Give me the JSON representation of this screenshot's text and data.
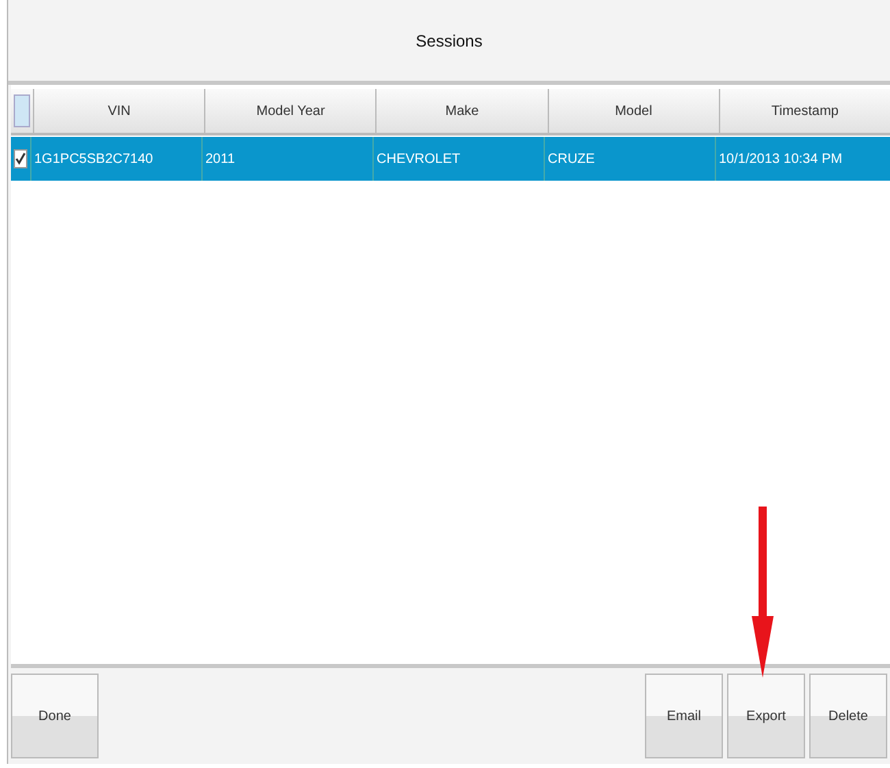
{
  "window": {
    "title": "Sessions"
  },
  "table": {
    "select_all": {
      "checked": false
    },
    "columns": [
      "VIN",
      "Model Year",
      "Make",
      "Model",
      "Timestamp"
    ],
    "rows": [
      {
        "checked": true,
        "selected": true,
        "cells": [
          "1G1PC5SB2C7140",
          "2011",
          "CHEVROLET",
          "CRUZE",
          "10/1/2013 10:34 PM"
        ]
      }
    ]
  },
  "left_buttons": [
    "Done"
  ],
  "right_buttons": [
    "Email",
    "Export",
    "Delete"
  ]
}
